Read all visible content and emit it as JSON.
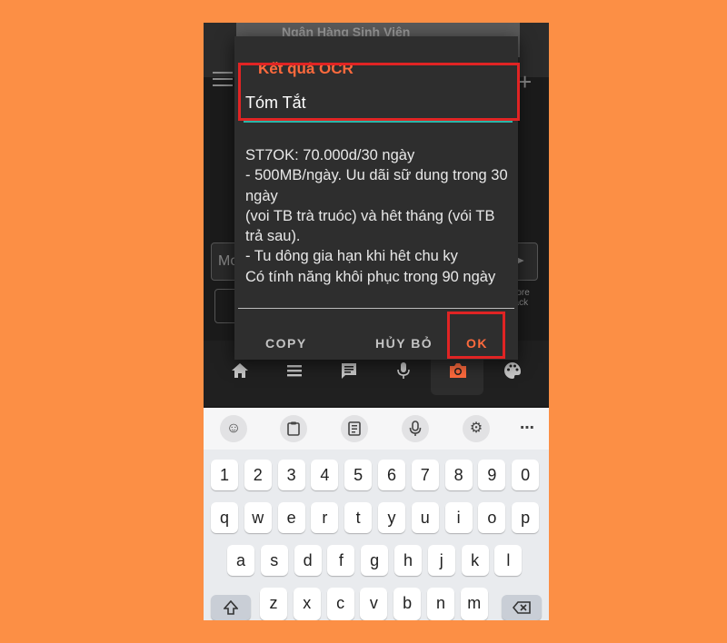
{
  "background_app": {
    "banner_text": "Ngân Hàng Sinh Viên",
    "input_placeholder": "Mo",
    "feedback_label": "more\nback"
  },
  "dialog": {
    "title": "Kết quả OCR",
    "name_field_value": "Tóm Tắt",
    "body_text": "ST7OK: 70.000d/30 ngày\n- 500MB/ngày. Uu dãi sữ dung trong 30 ngày\n(voi TB trà truóc) và hêt tháng (vói TB trả sau).\n- Tu dông gia hạn khi hêt chu ky\nCó tính năng khôi phục trong 90 ngày",
    "copy_label": "COPY",
    "cancel_label": "HỦY BỎ",
    "ok_label": "OK",
    "accent_color": "#ff6a3d",
    "highlight_color": "#e02424"
  },
  "bottom_nav": {
    "icons": [
      "home-icon",
      "list-icon",
      "chat-icon",
      "microphone-icon",
      "camera-icon",
      "palette-icon"
    ]
  },
  "keyboard": {
    "toolbar_icons": [
      "emoji-icon",
      "clipboard-icon",
      "sticker-icon",
      "microphone-icon",
      "settings-icon",
      "more-icon"
    ],
    "row_numbers": [
      "1",
      "2",
      "3",
      "4",
      "5",
      "6",
      "7",
      "8",
      "9",
      "0"
    ],
    "row_1": [
      "q",
      "w",
      "e",
      "r",
      "t",
      "y",
      "u",
      "i",
      "o",
      "p"
    ],
    "row_2": [
      "a",
      "s",
      "d",
      "f",
      "g",
      "h",
      "j",
      "k",
      "l"
    ],
    "row_3": [
      "z",
      "x",
      "c",
      "v",
      "b",
      "n",
      "m"
    ]
  }
}
